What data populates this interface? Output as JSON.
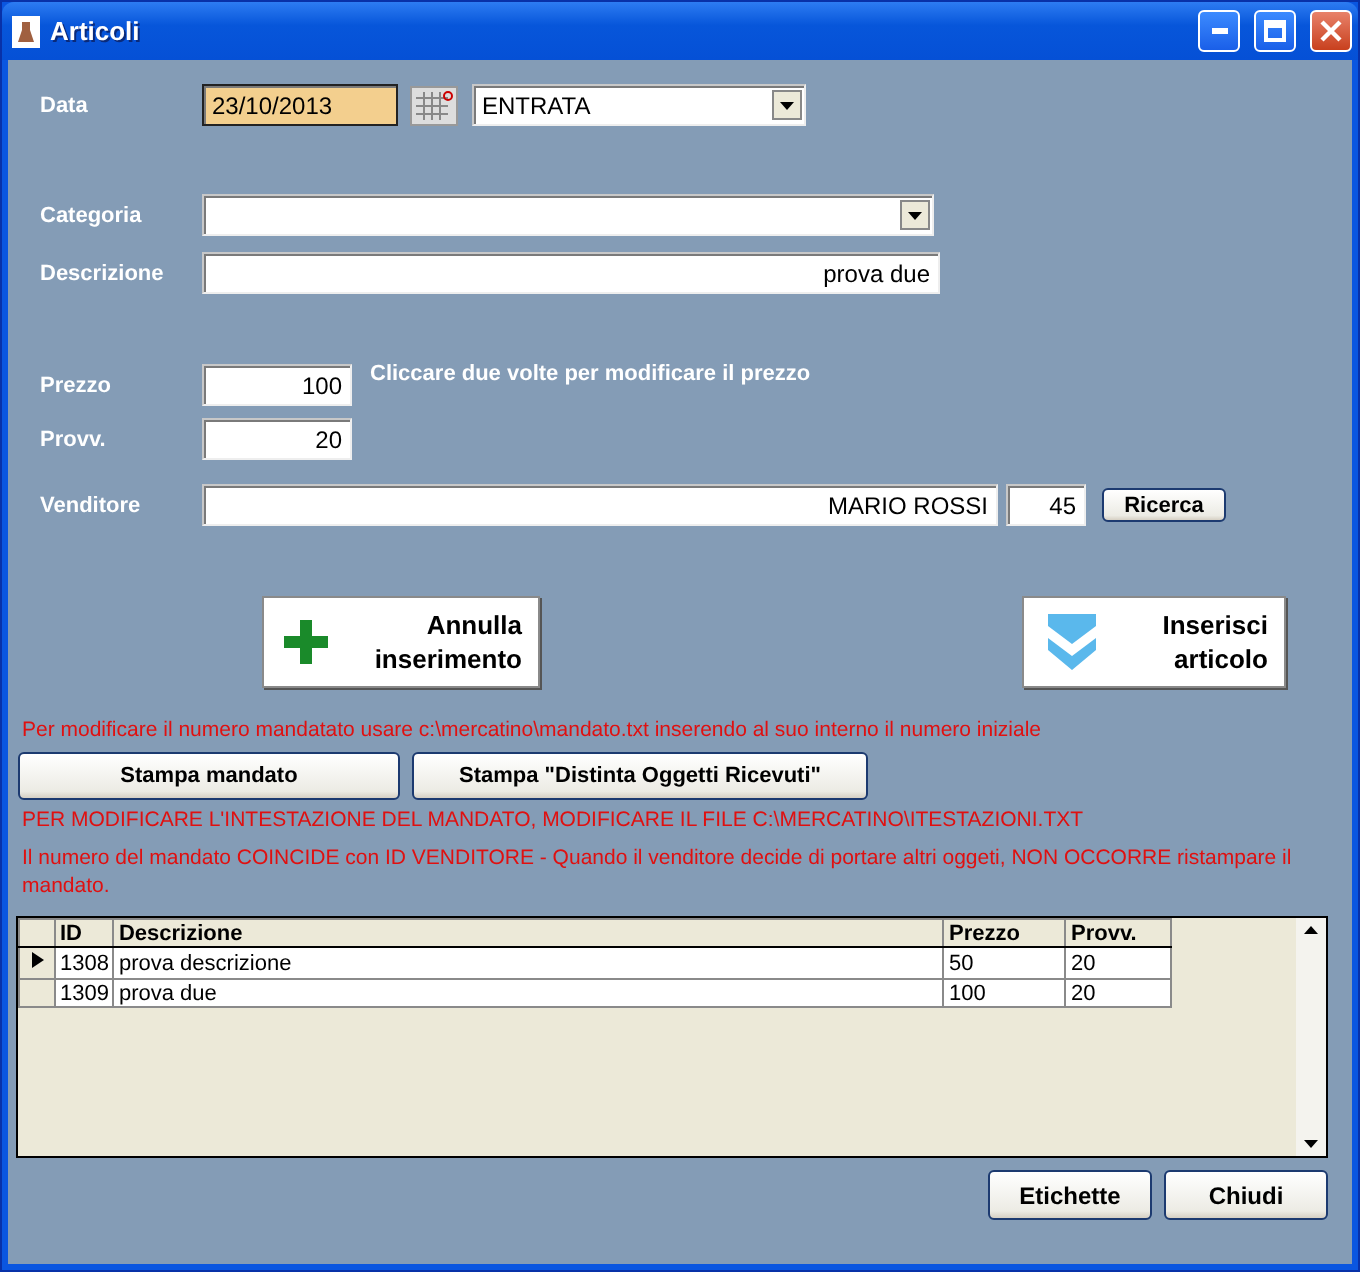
{
  "window": {
    "title": "Articoli"
  },
  "data": {
    "label": "Data",
    "date": "23/10/2013",
    "type_value": "ENTRATA"
  },
  "categoria": {
    "label": "Categoria"
  },
  "descrizione": {
    "label": "Descrizione",
    "value": "prova due"
  },
  "prezzo": {
    "label": "Prezzo",
    "value": "100",
    "hint": "Cliccare due volte per modificare il prezzo"
  },
  "provv": {
    "label": "Provv.",
    "value": "20"
  },
  "venditore": {
    "label": "Venditore",
    "name": "MARIO ROSSI",
    "id": "45",
    "search_button": "Ricerca"
  },
  "actions": [
    {
      "kind": "plus",
      "label": "Annulla inserimento"
    },
    {
      "kind": "insert",
      "label": "Inserisci articolo"
    }
  ],
  "note_1": "Per modificare il numero mandatato usare c:\\mercatino\\mandato.txt inserendo al suo interno il numero iniziale",
  "print_buttons": [
    "Stampa mandato",
    "Stampa \"Distinta Oggetti Ricevuti\""
  ],
  "note_2": "PER MODIFICARE L'INTESTAZIONE DEL MANDATO, MODIFICARE IL FILE C:\\MERCATINO\\ITESTAZIONI.TXT",
  "note_3": "Il numero del mandato COINCIDE con ID VENDITORE - Quando il venditore decide di portare altri oggeti, NON OCCORRE ristampare il mandato.",
  "table": {
    "columns": [
      "ID",
      "Descrizione",
      "Prezzo",
      "Provv."
    ],
    "rows": [
      {
        "selected": true,
        "cells": [
          "1308",
          "prova descrizione",
          "50",
          "20"
        ]
      },
      {
        "selected": false,
        "cells": [
          "1309",
          "prova due",
          "100",
          "20"
        ]
      }
    ]
  },
  "footer_buttons": [
    "Etichette",
    "Chiudi"
  ]
}
